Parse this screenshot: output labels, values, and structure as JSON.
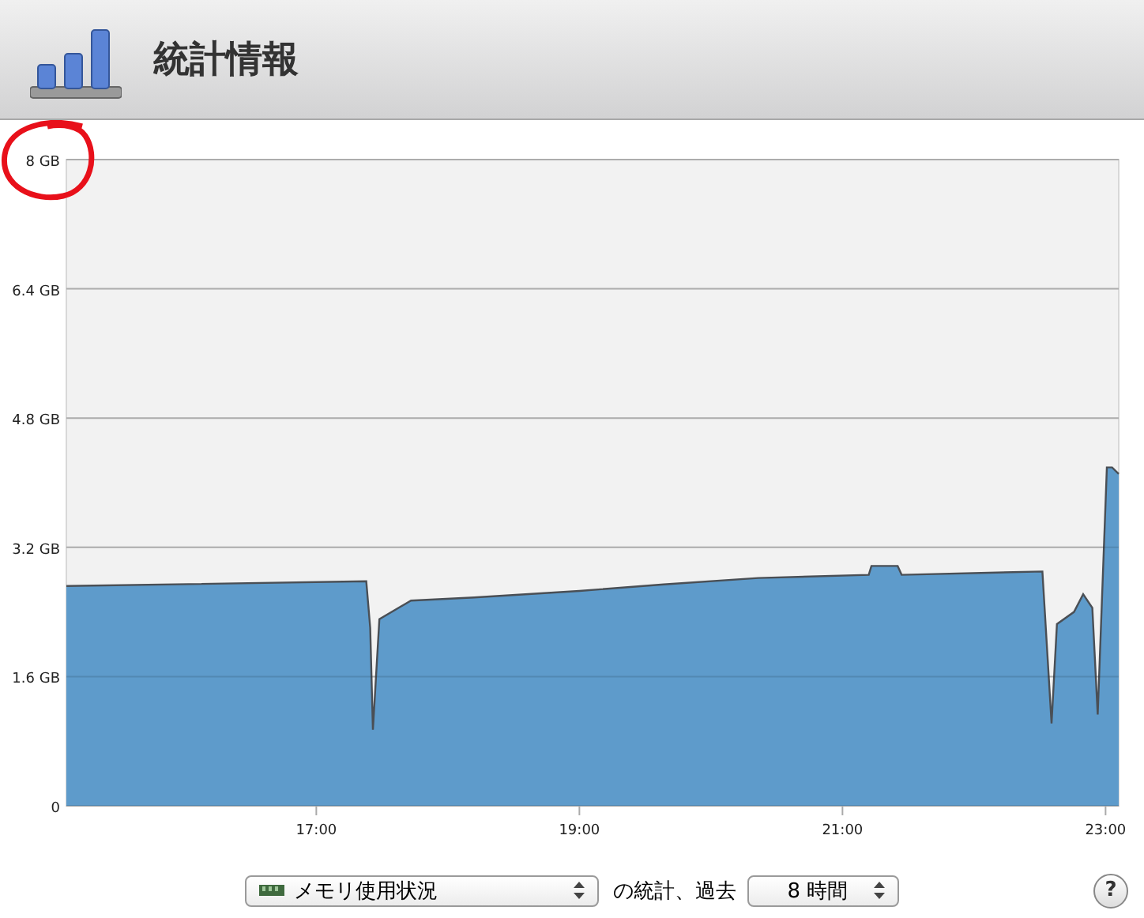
{
  "header": {
    "title": "統計情報"
  },
  "chart": {
    "chart_data": {
      "type": "area",
      "grid": true,
      "x": [
        15.1,
        17.38,
        17.41,
        17.43,
        17.48,
        17.72,
        18.2,
        19.0,
        19.64,
        20.36,
        21.2,
        21.22,
        21.42,
        21.45,
        22.52,
        22.59,
        22.63,
        22.76,
        22.83,
        22.9,
        22.94,
        23.01,
        23.05,
        23.1
      ],
      "series": [
        {
          "name": "メモリ使用状況",
          "color": "#5e9bcb",
          "values": [
            2.72,
            2.78,
            2.2,
            0.94,
            2.31,
            2.54,
            2.58,
            2.66,
            2.74,
            2.82,
            2.86,
            2.97,
            2.97,
            2.86,
            2.9,
            1.02,
            2.25,
            2.4,
            2.62,
            2.45,
            1.13,
            4.19,
            4.19,
            4.11
          ]
        }
      ],
      "xlim": [
        15.1,
        23.1
      ],
      "ylim": [
        0,
        8
      ],
      "xticks": [
        {
          "value": 17,
          "label": "17:00"
        },
        {
          "value": 19,
          "label": "19:00"
        },
        {
          "value": 21,
          "label": "21:00"
        },
        {
          "value": 23,
          "label": "23:00"
        }
      ],
      "yticks": [
        {
          "value": 0,
          "label": "0"
        },
        {
          "value": 1.6,
          "label": "1.6 GB"
        },
        {
          "value": 3.2,
          "label": "3.2 GB"
        },
        {
          "value": 4.8,
          "label": "4.8 GB"
        },
        {
          "value": 6.4,
          "label": "6.4 GB"
        },
        {
          "value": 8,
          "label": "8 GB"
        }
      ]
    }
  },
  "footer": {
    "between": "の統計、過去",
    "period": "8 時間",
    "help": "?"
  }
}
